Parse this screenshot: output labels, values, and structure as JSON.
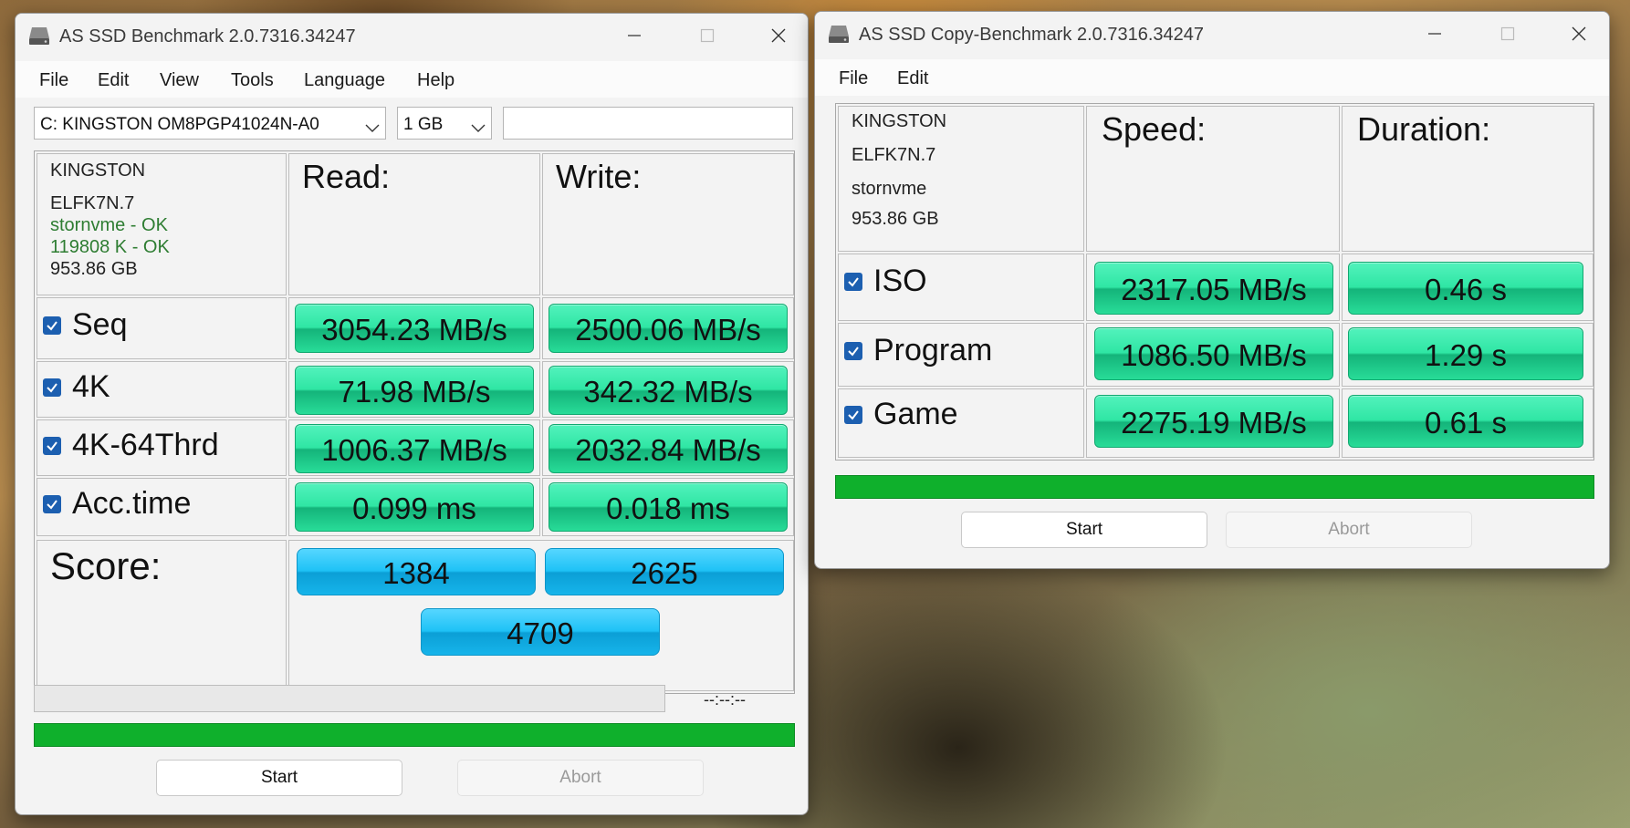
{
  "win1": {
    "title": "AS SSD Benchmark 2.0.7316.34247",
    "menu": [
      "File",
      "Edit",
      "View",
      "Tools",
      "Language",
      "Help"
    ],
    "drive_select": "C: KINGSTON OM8PGP41024N-A0",
    "size_select": "1 GB",
    "drive_info": {
      "model": "KINGSTON",
      "firmware": "ELFK7N.7",
      "driver": "stornvme - OK",
      "align": "119808 K - OK",
      "capacity": "953.86 GB"
    },
    "read_header": "Read:",
    "write_header": "Write:",
    "rows": [
      {
        "label": "Seq",
        "read": "3054.23 MB/s",
        "write": "2500.06 MB/s",
        "checked": true
      },
      {
        "label": "4K",
        "read": "71.98 MB/s",
        "write": "342.32 MB/s",
        "checked": true
      },
      {
        "label": "4K-64Thrd",
        "read": "1006.37 MB/s",
        "write": "2032.84 MB/s",
        "checked": true
      },
      {
        "label": "Acc.time",
        "read": "0.099 ms",
        "write": "0.018 ms",
        "checked": true
      }
    ],
    "score_label": "Score:",
    "score_read": "1384",
    "score_write": "2625",
    "score_total": "4709",
    "elapsed": "--:--:--",
    "progress_top": 0,
    "progress_green": 1,
    "start_label": "Start",
    "abort_label": "Abort"
  },
  "win2": {
    "title": "AS SSD Copy-Benchmark 2.0.7316.34247",
    "menu": [
      "File",
      "Edit"
    ],
    "drive_info": {
      "model": "KINGSTON",
      "firmware": "ELFK7N.7",
      "driver": "stornvme",
      "capacity": "953.86 GB"
    },
    "speed_header": "Speed:",
    "duration_header": "Duration:",
    "rows": [
      {
        "label": "ISO",
        "speed": "2317.05 MB/s",
        "duration": "0.46 s",
        "checked": true
      },
      {
        "label": "Program",
        "speed": "1086.50 MB/s",
        "duration": "1.29 s",
        "checked": true
      },
      {
        "label": "Game",
        "speed": "2275.19 MB/s",
        "duration": "0.61 s",
        "checked": true
      }
    ],
    "progress_green": 1,
    "start_label": "Start",
    "abort_label": "Abort"
  },
  "colors": {
    "accent_green": "#2fe6a4",
    "score_blue": "#1ec2f6",
    "progress_green": "#0fb02c",
    "checkbox_blue": "#1c5fb0"
  },
  "icons": [
    "drive-icon",
    "minimize-icon",
    "maximize-icon",
    "close-icon",
    "chevron-down-icon",
    "checkmark-icon"
  ]
}
